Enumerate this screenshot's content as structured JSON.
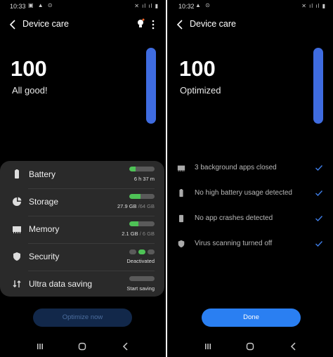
{
  "left": {
    "status_bar": {
      "time": "10:33"
    },
    "header": {
      "title": "Device care",
      "icons": [
        "back-arrow-icon",
        "lightbulb-icon",
        "more-options-icon"
      ]
    },
    "score": "100",
    "status_message": "All good!",
    "score_level": 1.0,
    "card": {
      "items": [
        {
          "label": "Battery",
          "value": "6 h 37 m",
          "icon": "battery-icon",
          "level": 0.25
        },
        {
          "label": "Storage",
          "value_main": "27.9 GB",
          "value_total": "/64 GB",
          "icon": "storage-icon",
          "level": 0.44
        },
        {
          "label": "Memory",
          "value_main": "2.1 GB",
          "value_total": "/ 6 GB",
          "icon": "memory-icon",
          "level": 0.35
        },
        {
          "label": "Security",
          "value": "Deactivated",
          "icon": "shield-icon"
        },
        {
          "label": "Ultra data saving",
          "value": "Start saving",
          "icon": "data-saving-icon"
        }
      ]
    },
    "button": {
      "label": "Optimize now"
    }
  },
  "right": {
    "status_bar": {
      "time": "10:32"
    },
    "header": {
      "title": "Device care",
      "icons": [
        "back-arrow-icon"
      ]
    },
    "score": "100",
    "status_message": "Optimized",
    "score_level": 1.0,
    "results": [
      {
        "label": "3 background apps closed",
        "icon": "memory-icon"
      },
      {
        "label": "No high battery usage detected",
        "icon": "battery-icon"
      },
      {
        "label": "No app crashes detected",
        "icon": "phone-icon"
      },
      {
        "label": "Virus scanning turned off",
        "icon": "shield-icon"
      }
    ],
    "button": {
      "label": "Done"
    }
  },
  "colors": {
    "accent_blue": "#3f6ce0",
    "gauge_green": "#4ec256",
    "check_blue": "#3f7ee8",
    "done_blue": "#2a7ff2"
  },
  "nav_icons": [
    "recents-icon",
    "home-icon",
    "back-icon"
  ]
}
